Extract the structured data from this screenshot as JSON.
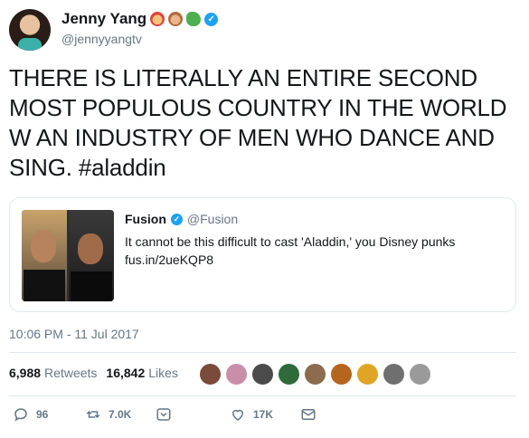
{
  "author": {
    "display_name": "Jenny Yang",
    "handle": "@jennyyangtv",
    "verified": true,
    "name_emojis": [
      "fairy-emoji",
      "woman-emoji",
      "dragon-emoji"
    ]
  },
  "tweet": {
    "text": "THERE IS LITERALLY AN ENTIRE SECOND MOST POPULOUS COUNTRY IN THE WORLD W AN INDUSTRY OF MEN WHO DANCE AND SING. #aladdin",
    "timestamp": "10:06 PM - 11 Jul 2017"
  },
  "quoted_tweet": {
    "display_name": "Fusion",
    "handle": "@Fusion",
    "verified": true,
    "text": "It cannot be this difficult to cast 'Aladdin,' you Disney punks",
    "link": "fus.in/2ueKQP8"
  },
  "stats": {
    "retweets_count": "6,988",
    "retweets_label": "Retweets",
    "likes_count": "16,842",
    "likes_label": "Likes"
  },
  "likers": [
    "#7a4b3a",
    "#c98fa8",
    "#4b4b4b",
    "#2f6b3a",
    "#8c6b4f",
    "#b5651d",
    "#e0a526",
    "#6f6f6f",
    "#9a9a9a"
  ],
  "actions": {
    "reply_count": "96",
    "retweet_count": "7.0K",
    "like_count": "17K"
  },
  "colors": {
    "accent": "#1da1f2",
    "secondary_text": "#657786",
    "border": "#e1e8ed"
  }
}
